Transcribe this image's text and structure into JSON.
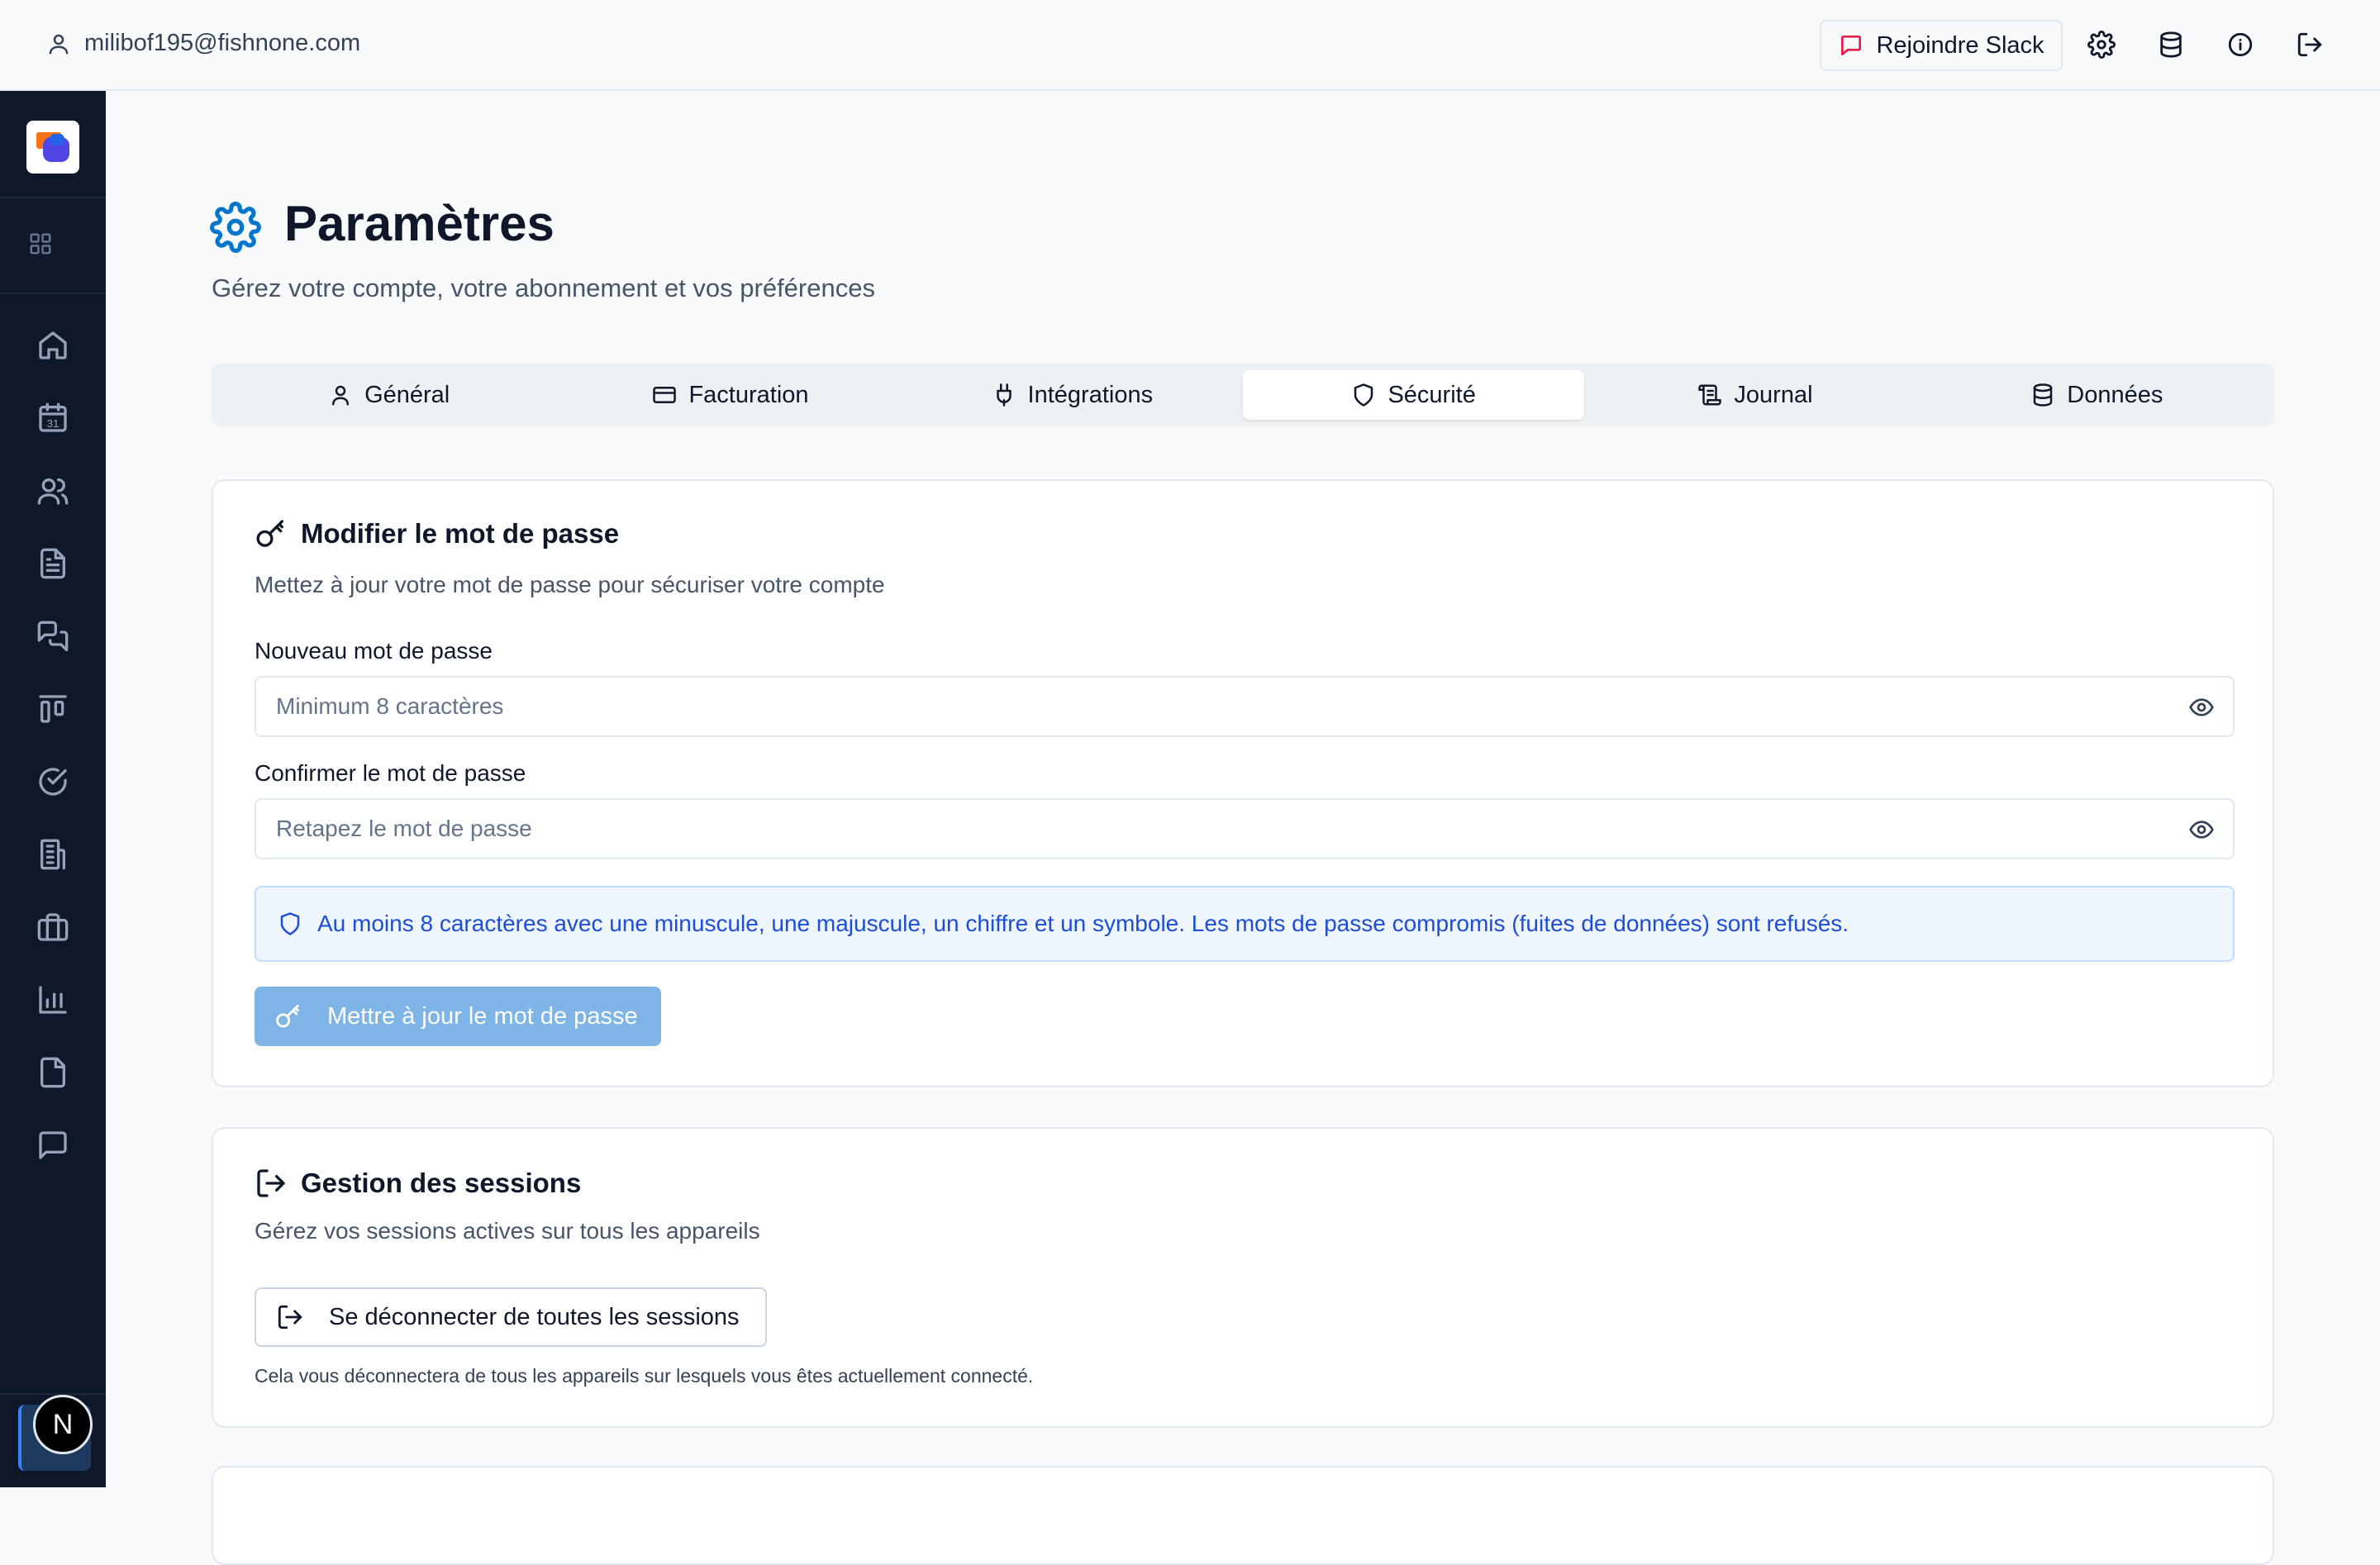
{
  "header": {
    "user_email": "milibof195@fishnone.com",
    "slack_label": "Rejoindre Slack",
    "icons": [
      "user-icon",
      "message-square-icon",
      "gear-icon",
      "database-icon",
      "info-icon",
      "logout-icon"
    ]
  },
  "sidebar": {
    "logo": "app-logo",
    "items": [
      "grid-icon",
      "home-icon",
      "calendar-icon",
      "users-icon",
      "document-icon",
      "messages-icon",
      "kanban-icon",
      "check-circle-icon",
      "building-icon",
      "briefcase-icon",
      "bar-chart-icon",
      "file-icon",
      "chat-icon"
    ],
    "calendar_day": "31",
    "badge_letter": "N"
  },
  "page": {
    "title": "Paramètres",
    "subtitle": "Gérez votre compte, votre abonnement et vos préférences"
  },
  "tabs": [
    {
      "label": "Général",
      "icon": "user-icon"
    },
    {
      "label": "Facturation",
      "icon": "credit-card-icon"
    },
    {
      "label": "Intégrations",
      "icon": "plug-icon"
    },
    {
      "label": "Sécurité",
      "icon": "shield-icon",
      "active": true
    },
    {
      "label": "Journal",
      "icon": "scroll-icon"
    },
    {
      "label": "Données",
      "icon": "database-icon"
    }
  ],
  "password_card": {
    "title": "Modifier le mot de passe",
    "description": "Mettez à jour votre mot de passe pour sécuriser votre compte",
    "new_label": "Nouveau mot de passe",
    "new_placeholder": "Minimum 8 caractères",
    "confirm_label": "Confirmer le mot de passe",
    "confirm_placeholder": "Retapez le mot de passe",
    "hint": "Au moins 8 caractères avec une minuscule, une majuscule, un chiffre et un symbole. Les mots de passe compromis (fuites de données) sont refusés.",
    "submit_label": "Mettre à jour le mot de passe"
  },
  "sessions_card": {
    "title": "Gestion des sessions",
    "description": "Gérez vos sessions actives sur tous les appareils",
    "button_label": "Se déconnecter de toutes les sessions",
    "note": "Cela vous déconnectera de tous les appareils sur lesquels vous êtes actuellement connecté."
  },
  "colors": {
    "accent": "#0077cc",
    "sidebar_bg": "#0f172a",
    "info_text": "#1d4ed8",
    "disabled_button": "#7fb5e6",
    "slack_icon": "#e11d48"
  }
}
